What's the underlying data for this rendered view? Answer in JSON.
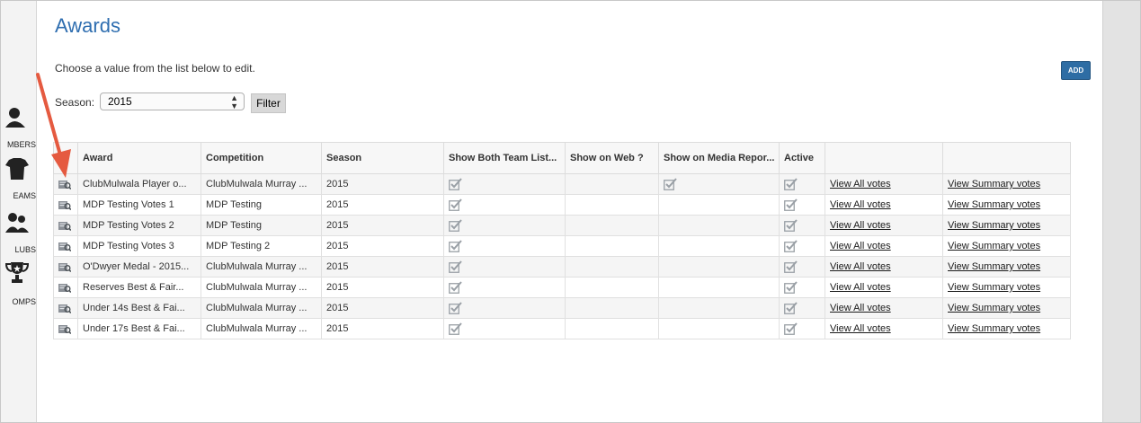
{
  "page": {
    "title": "Awards",
    "instructions": "Choose a value from the list below to edit."
  },
  "toolbar": {
    "add_label": "ADD"
  },
  "filter": {
    "season_label": "Season:",
    "season_value": "2015",
    "filter_label": "Filter"
  },
  "nav": {
    "members": "MBERS",
    "teams": "EAMS",
    "clubs": "LUBS",
    "comps": "OMPS"
  },
  "table": {
    "headers": [
      "Award",
      "Competition",
      "Season",
      "Show Both Team List...",
      "Show on Web ?",
      "Show on Media Repor...",
      "Active",
      "",
      ""
    ],
    "rows": [
      {
        "award": "ClubMulwala Player o...",
        "competition": "ClubMulwala Murray ...",
        "season": "2015",
        "both": true,
        "web": false,
        "media": true,
        "active": true,
        "votes": "View All votes",
        "summary": "View Summary votes"
      },
      {
        "award": "MDP Testing Votes 1",
        "competition": "MDP Testing",
        "season": "2015",
        "both": true,
        "web": false,
        "media": false,
        "active": true,
        "votes": "View All votes",
        "summary": "View Summary votes"
      },
      {
        "award": "MDP Testing Votes 2",
        "competition": "MDP Testing",
        "season": "2015",
        "both": true,
        "web": false,
        "media": false,
        "active": true,
        "votes": "View All votes",
        "summary": "View Summary votes"
      },
      {
        "award": "MDP Testing Votes 3",
        "competition": "MDP Testing 2",
        "season": "2015",
        "both": true,
        "web": false,
        "media": false,
        "active": true,
        "votes": "View All votes",
        "summary": "View Summary votes"
      },
      {
        "award": "O'Dwyer Medal - 2015...",
        "competition": "ClubMulwala Murray ...",
        "season": "2015",
        "both": true,
        "web": false,
        "media": false,
        "active": true,
        "votes": "View All votes",
        "summary": "View Summary votes"
      },
      {
        "award": "Reserves Best & Fair...",
        "competition": "ClubMulwala Murray ...",
        "season": "2015",
        "both": true,
        "web": false,
        "media": false,
        "active": true,
        "votes": "View All votes",
        "summary": "View Summary votes"
      },
      {
        "award": "Under 14s Best & Fai...",
        "competition": "ClubMulwala Murray ...",
        "season": "2015",
        "both": true,
        "web": false,
        "media": false,
        "active": true,
        "votes": "View All votes",
        "summary": "View Summary votes"
      },
      {
        "award": "Under 17s Best & Fai...",
        "competition": "ClubMulwala Murray ...",
        "season": "2015",
        "both": true,
        "web": false,
        "media": false,
        "active": true,
        "votes": "View All votes",
        "summary": "View Summary votes"
      }
    ]
  },
  "colors": {
    "title": "#2f6eb0",
    "add_button": "#2e6da4",
    "arrow": "#e55a40"
  },
  "icons": {
    "edit": "edit-record-icon",
    "check": "checkmark-icon"
  }
}
